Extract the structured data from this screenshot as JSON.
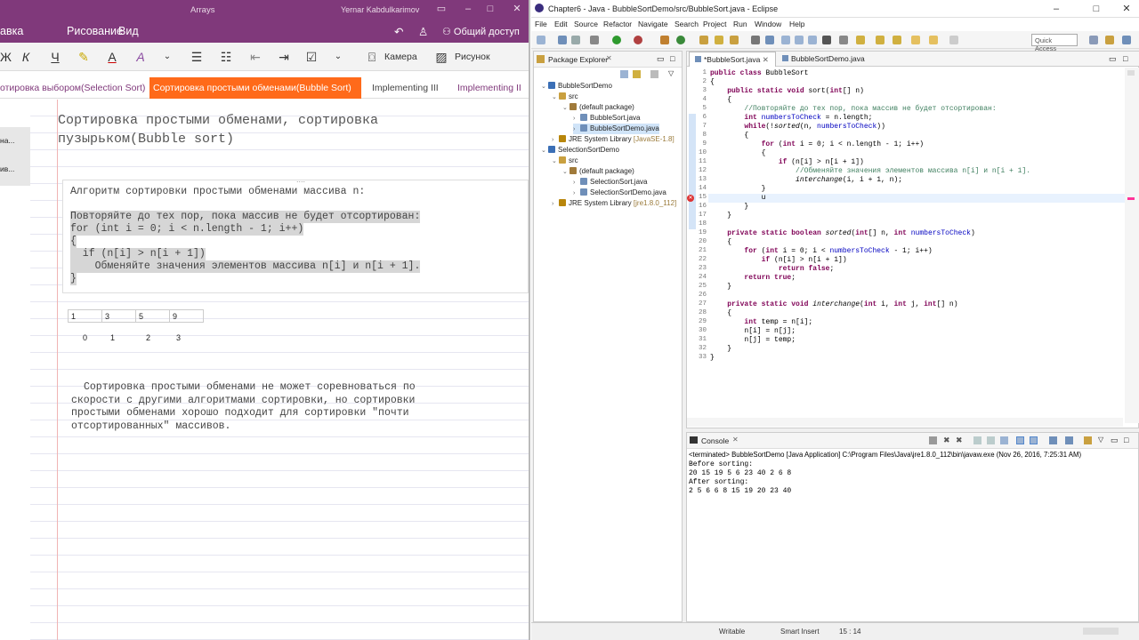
{
  "onenote": {
    "title": "Arrays",
    "user": "Yernar Kabdulkarimov",
    "menu": [
      "авка",
      "Рисование",
      "Вид"
    ],
    "share_label": "Общий доступ",
    "ribbon": {
      "camera": "Камера",
      "picture": "Рисунок",
      "bold": "Ж",
      "italic": "К",
      "underline": "Ч"
    },
    "tabs": [
      "отировка выбором(Selection Sort)",
      "Сортировка простыми обменами(Bubble Sort)",
      "Implementing III",
      "Implementing II"
    ],
    "side_items": [
      "на...",
      "ив..."
    ],
    "page_title": "Сортировка простыми обменами, сортировка пузырьком(Bubble sort)",
    "algo_heading": "Алгоритм сортировки простыми обменами массива n:",
    "code": [
      "Повторяйте до тех пор, пока массив не будет отсортирован:",
      "for (int i = 0; i < n.length - 1; i++)",
      "{",
      "  if (n[i] > n[i + 1])",
      "    Обменяйте значения элементов массива n[i] и n[i + 1].",
      "}"
    ],
    "array_values": [
      "1",
      "3",
      "5",
      "9"
    ],
    "array_indices": [
      "0",
      "1",
      "2",
      "3"
    ],
    "paragraph": "Сортировка простыми обменами не может соревноваться по скорости с другими алгоритмами сортировки, но сортировки простыми обменами хорошо подходит для сортировки \"почти отсортированных\" массивов."
  },
  "eclipse": {
    "title": "Chapter6 - Java - BubbleSortDemo/src/BubbleSort.java - Eclipse",
    "menu": [
      "File",
      "Edit",
      "Source",
      "Refactor",
      "Navigate",
      "Search",
      "Project",
      "Run",
      "Window",
      "Help"
    ],
    "quick_access": "Quick Access",
    "package_explorer": {
      "label": "Package Explorer",
      "tree": [
        {
          "text": "BubbleSortDemo",
          "indent": 0
        },
        {
          "text": "src",
          "indent": 1
        },
        {
          "text": "(default package)",
          "indent": 2
        },
        {
          "text": "BubbleSort.java",
          "indent": 3
        },
        {
          "text": "BubbleSortDemo.java",
          "indent": 3
        },
        {
          "text": "JRE System Library [JavaSE-1.8]",
          "indent": 1
        },
        {
          "text": "SelectionSortDemo",
          "indent": 0
        },
        {
          "text": "src",
          "indent": 1
        },
        {
          "text": "(default package)",
          "indent": 2
        },
        {
          "text": "SelectionSort.java",
          "indent": 3
        },
        {
          "text": "SelectionSortDemo.java",
          "indent": 3
        },
        {
          "text": "JRE System Library [jre1.8.0_112]",
          "indent": 1
        }
      ]
    },
    "editor_tabs": [
      "*BubbleSort.java",
      "BubbleSortDemo.java"
    ],
    "code_lines": [
      {
        "n": "1",
        "t": "public class BubbleSort"
      },
      {
        "n": "2",
        "t": "{"
      },
      {
        "n": "3",
        "t": "    public static void sort(int[] n)"
      },
      {
        "n": "4",
        "t": "    {"
      },
      {
        "n": "5",
        "t": "        //Повторяйте до тех пор, пока массив не будет отсортирован:"
      },
      {
        "n": "6",
        "t": "        int numbersToCheck = n.length;"
      },
      {
        "n": "7",
        "t": "        while(!sorted(n, numbersToCheck))"
      },
      {
        "n": "8",
        "t": "        {"
      },
      {
        "n": "9",
        "t": "            for (int i = 0; i < n.length - 1; i++)"
      },
      {
        "n": "10",
        "t": "            {"
      },
      {
        "n": "11",
        "t": "                if (n[i] > n[i + 1])"
      },
      {
        "n": "12",
        "t": "                    //Обменяйте значения элементов массива n[i] и n[i + 1]."
      },
      {
        "n": "13",
        "t": "                    interchange(i, i + 1, n);"
      },
      {
        "n": "14",
        "t": "            }"
      },
      {
        "n": "15",
        "t": "            u"
      },
      {
        "n": "16",
        "t": "        }"
      },
      {
        "n": "17",
        "t": "    }"
      },
      {
        "n": "18",
        "t": ""
      },
      {
        "n": "19",
        "t": "    private static boolean sorted(int[] n, int numbersToCheck)"
      },
      {
        "n": "20",
        "t": "    {"
      },
      {
        "n": "21",
        "t": "        for (int i = 0; i < numbersToCheck - 1; i++)"
      },
      {
        "n": "22",
        "t": "            if (n[i] > n[i + 1])"
      },
      {
        "n": "23",
        "t": "                return false;"
      },
      {
        "n": "24",
        "t": "        return true;"
      },
      {
        "n": "25",
        "t": "    }"
      },
      {
        "n": "26",
        "t": ""
      },
      {
        "n": "27",
        "t": "    private static void interchange(int i, int j, int[] n)"
      },
      {
        "n": "28",
        "t": "    {"
      },
      {
        "n": "29",
        "t": "        int temp = n[i];"
      },
      {
        "n": "30",
        "t": "        n[i] = n[j];"
      },
      {
        "n": "31",
        "t": "        n[j] = temp;"
      },
      {
        "n": "32",
        "t": "    }"
      },
      {
        "n": "33",
        "t": "}"
      }
    ],
    "console": {
      "label": "Console",
      "header": "<terminated> BubbleSortDemo [Java Application] C:\\Program Files\\Java\\jre1.8.0_112\\bin\\javaw.exe (Nov 26, 2016, 7:25:31 AM)",
      "lines": [
        "Before sorting:",
        "20 15 19 5 6 23 40 2 6 8",
        "After sorting:",
        "2 5 6 6 8 15 19 20 23 40"
      ]
    },
    "status": {
      "writable": "Writable",
      "insert": "Smart Insert",
      "position": "15 : 14"
    }
  },
  "colors": {
    "onenote_purple": "#80397b",
    "active_tab": "#ff6a1a",
    "keyword": "#7f0055",
    "comment": "#3f7f5f"
  }
}
